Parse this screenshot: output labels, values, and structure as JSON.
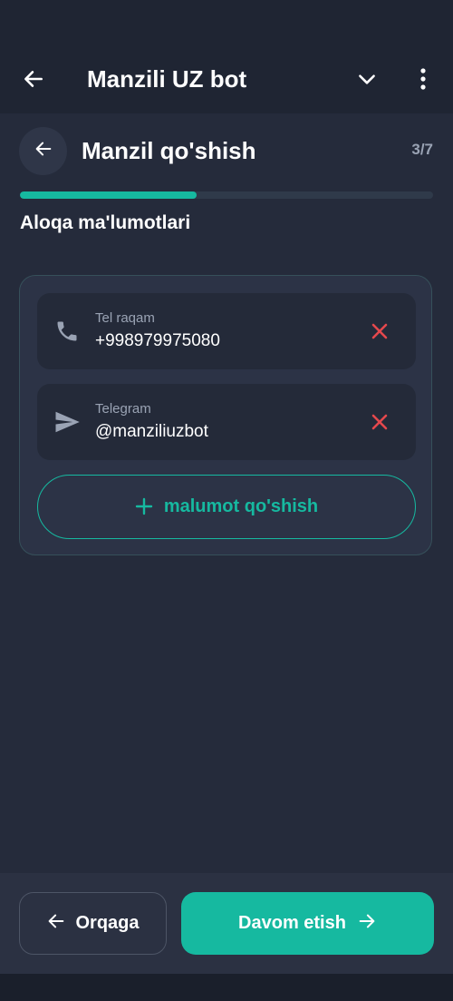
{
  "header": {
    "title": "Manzili UZ bot"
  },
  "step": {
    "title": "Manzil qo'shish",
    "counter": "3/7",
    "progress_fraction": 0.4286
  },
  "section": {
    "title": "Aloqa ma'lumotlari"
  },
  "contacts": [
    {
      "label": "Tel raqam",
      "value": "+998979975080",
      "icon": "phone-icon"
    },
    {
      "label": "Telegram",
      "value": "@manziliuzbot",
      "icon": "send-icon"
    }
  ],
  "add_button": {
    "label": "malumot qo'shish"
  },
  "footer": {
    "back_label": "Orqaga",
    "next_label": "Davom etish"
  },
  "colors": {
    "accent": "#16b9a0",
    "delete": "#e5484d",
    "background": "#252b3b"
  }
}
